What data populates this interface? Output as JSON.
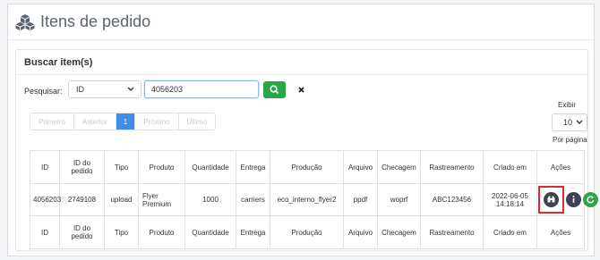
{
  "page": {
    "title": "Itens de pedido"
  },
  "search": {
    "card_title": "Buscar item(s)",
    "label": "Pesquisar:",
    "field_selected": "ID",
    "query_value": "4056203"
  },
  "pagination": {
    "first": "Primeiro",
    "previous": "Anterior",
    "current": "1",
    "next": "Próximo",
    "last": "Último"
  },
  "page_size": {
    "label_top": "Exibir",
    "value": "10",
    "label_bottom": "Por página"
  },
  "table": {
    "columns": [
      "ID",
      "ID do pedido",
      "Tipo",
      "Produto",
      "Quantidade",
      "Entrega",
      "Produção",
      "Arquivo",
      "Checagem",
      "Rastreamento",
      "Criado em",
      "Ações"
    ],
    "rows": [
      {
        "id": "4056203",
        "order_id": "2749108",
        "type": "upload",
        "product": "Flyer Premium",
        "quantity": "1000",
        "delivery": "carriers",
        "production": "eco_interno_flyer2",
        "file": "ppdf",
        "check": "woprf",
        "tracking": "ABC123456",
        "created_at": "2022-06-05 14:18:14"
      }
    ]
  },
  "icons": {
    "header": "cubes-icon",
    "search_button": "search-icon",
    "clear_button": "close-icon",
    "row_actions": [
      "binoculars-icon",
      "info-icon",
      "refresh-icon"
    ]
  },
  "colors": {
    "search_button": "#28a745",
    "pagination_active": "#3d8fe6",
    "action_dark": "#3b4350",
    "action_green": "#2ea44f",
    "highlight": "#e0282e"
  }
}
